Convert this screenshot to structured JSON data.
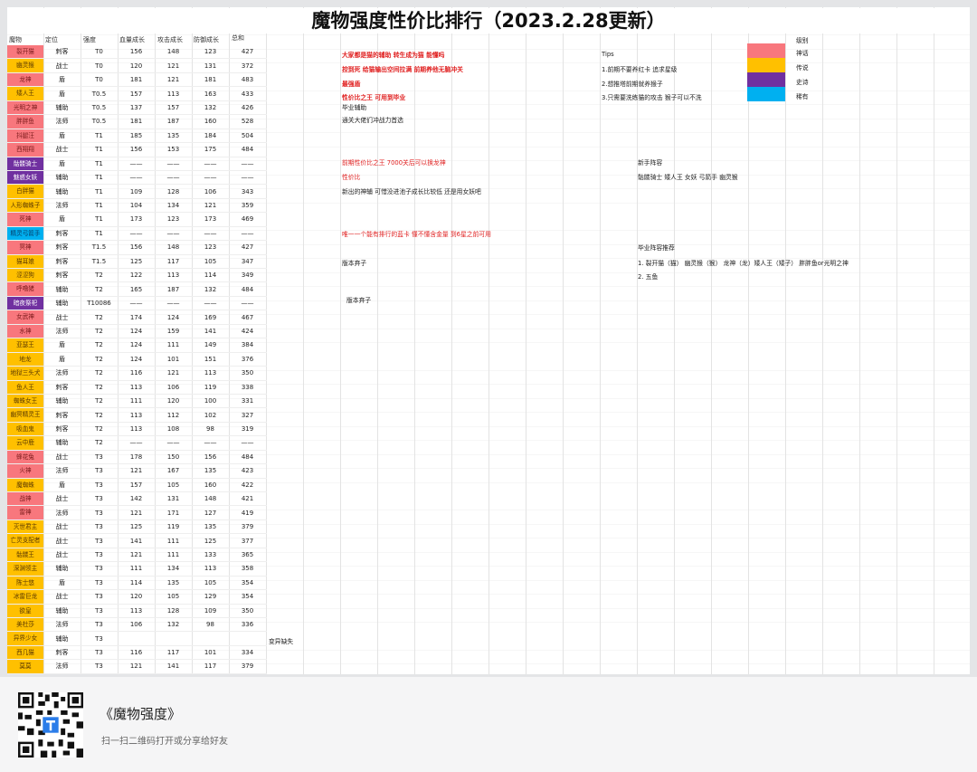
{
  "title": "魔物强度性价比排行（2023.2.28更新）",
  "headers": [
    "魔物",
    "定位",
    "强度",
    "血量成长",
    "攻击成长",
    "防御成长",
    "总和"
  ],
  "levels": {
    "label": "级别",
    "items": [
      {
        "name": "神话",
        "color": "#f8777d"
      },
      {
        "name": "传说",
        "color": "#ffc000"
      },
      {
        "name": "史诗",
        "color": "#7030a0"
      },
      {
        "name": "稀有",
        "color": "#00b0f0"
      }
    ]
  },
  "rows": [
    [
      "裂开猫",
      "刺客",
      "T0",
      "156",
      "148",
      "123",
      "427",
      0
    ],
    [
      "幽灵猴",
      "战士",
      "T0",
      "120",
      "121",
      "131",
      "372",
      1
    ],
    [
      "龙神",
      "盾",
      "T0",
      "181",
      "121",
      "181",
      "483",
      0
    ],
    [
      "矮人王",
      "盾",
      "T0.5",
      "157",
      "113",
      "163",
      "433",
      1
    ],
    [
      "光明之神",
      "辅助",
      "T0.5",
      "137",
      "157",
      "132",
      "426",
      0
    ],
    [
      "胖胖鱼",
      "法师",
      "T0.5",
      "181",
      "187",
      "160",
      "528",
      0
    ],
    [
      "抖腿汪",
      "盾",
      "T1",
      "185",
      "135",
      "184",
      "504",
      0
    ],
    [
      "西翔翔",
      "战士",
      "T1",
      "156",
      "153",
      "175",
      "484",
      0
    ],
    [
      "骷髅骑士",
      "盾",
      "T1",
      "——",
      "——",
      "——",
      "——",
      2
    ],
    [
      "魅惑女妖",
      "辅助",
      "T1",
      "——",
      "——",
      "——",
      "——",
      2
    ],
    [
      "白胖猫",
      "辅助",
      "T1",
      "109",
      "128",
      "106",
      "343",
      1
    ],
    [
      "人形蜘蛛子",
      "法师",
      "T1",
      "104",
      "134",
      "121",
      "359",
      1
    ],
    [
      "死神",
      "盾",
      "T1",
      "173",
      "123",
      "173",
      "469",
      0
    ],
    [
      "精灵弓箭手",
      "刺客",
      "T1",
      "——",
      "——",
      "——",
      "——",
      3
    ],
    [
      "冥神",
      "刺客",
      "T1.5",
      "156",
      "148",
      "123",
      "427",
      0
    ],
    [
      "猫耳娘",
      "刺客",
      "T1.5",
      "125",
      "117",
      "105",
      "347",
      1
    ],
    [
      "涩涩狗",
      "刺客",
      "T2",
      "122",
      "113",
      "114",
      "349",
      1
    ],
    [
      "呼噜猪",
      "辅助",
      "T2",
      "165",
      "187",
      "132",
      "484",
      0
    ],
    [
      "暗夜祭祀",
      "辅助",
      "T10086",
      "——",
      "——",
      "——",
      "——",
      2
    ],
    [
      "女武神",
      "战士",
      "T2",
      "174",
      "124",
      "169",
      "467",
      0
    ],
    [
      "水神",
      "法师",
      "T2",
      "124",
      "159",
      "141",
      "424",
      0
    ],
    [
      "亚瑟王",
      "盾",
      "T2",
      "124",
      "111",
      "149",
      "384",
      1
    ],
    [
      "地龙",
      "盾",
      "T2",
      "124",
      "101",
      "151",
      "376",
      1
    ],
    [
      "地狱三头犬",
      "法师",
      "T2",
      "116",
      "121",
      "113",
      "350",
      1
    ],
    [
      "鱼人王",
      "刺客",
      "T2",
      "113",
      "106",
      "119",
      "338",
      1
    ],
    [
      "蜘蛛女王",
      "辅助",
      "T2",
      "111",
      "120",
      "100",
      "331",
      1
    ],
    [
      "幽冥精灵王",
      "刺客",
      "T2",
      "113",
      "112",
      "102",
      "327",
      1
    ],
    [
      "吸血鬼",
      "刺客",
      "T2",
      "113",
      "108",
      "98",
      "319",
      1
    ],
    [
      "云中鹿",
      "辅助",
      "T2",
      "——",
      "——",
      "——",
      "——",
      1
    ],
    [
      "蜂花兔",
      "战士",
      "T3",
      "178",
      "150",
      "156",
      "484",
      0
    ],
    [
      "火神",
      "法师",
      "T3",
      "121",
      "167",
      "135",
      "423",
      0
    ],
    [
      "魔蜘蛛",
      "盾",
      "T3",
      "157",
      "105",
      "160",
      "422",
      1
    ],
    [
      "战神",
      "战士",
      "T3",
      "142",
      "131",
      "148",
      "421",
      0
    ],
    [
      "雷神",
      "法师",
      "T3",
      "121",
      "171",
      "127",
      "419",
      0
    ],
    [
      "灭世君主",
      "战士",
      "T3",
      "125",
      "119",
      "135",
      "379",
      1
    ],
    [
      "亡灵支配者",
      "战士",
      "T3",
      "141",
      "111",
      "125",
      "377",
      1
    ],
    [
      "骷髅王",
      "战士",
      "T3",
      "121",
      "111",
      "133",
      "365",
      1
    ],
    [
      "深渊领主",
      "辅助",
      "T3",
      "111",
      "134",
      "113",
      "358",
      1
    ],
    [
      "陈士悠",
      "盾",
      "T3",
      "114",
      "135",
      "105",
      "354",
      1
    ],
    [
      "冰雷巨龙",
      "战士",
      "T3",
      "120",
      "105",
      "129",
      "354",
      1
    ],
    [
      "欲皇",
      "辅助",
      "T3",
      "113",
      "128",
      "109",
      "350",
      1
    ],
    [
      "美杜莎",
      "法师",
      "T3",
      "106",
      "132",
      "98",
      "336",
      1
    ],
    [
      "异界少女",
      "辅助",
      "T3",
      "",
      "",
      "",
      "",
      1
    ],
    [
      "西几猫",
      "刺客",
      "T3",
      "116",
      "117",
      "101",
      "334",
      1
    ],
    [
      "莫莫",
      "法师",
      "T3",
      "121",
      "141",
      "117",
      "379",
      1
    ]
  ],
  "notes": {
    "n1": "大家都是猫的辅助 转生成为猫 能懂吗",
    "n2": "控到死  给猫输出空间拉满  前期养他无脑冲关",
    "n3": "最强盾",
    "n4": "性价比之王  可用到毕业",
    "n5": "毕业辅助",
    "n6": "通关大佬们冲战力首选",
    "n7": "前期性价比之王  7000关后可以换龙神",
    "n8": "性价比",
    "n9": "新出的神辅   可惜没进池子成长比较低  还是用女妖吧",
    "n10": "唯一一个能有排行的蓝卡 懂不懂含金量   到6星之前可用",
    "n11": "版本弃子",
    "n12": "版本弃子",
    "n13": "变异缺失"
  },
  "tips": {
    "title": "Tips",
    "items": [
      "1.前期不要养红卡  追求星级",
      "2.想推塔前期就养猴子",
      "3.只需要洗练猫的攻击  猴子可以不洗"
    ]
  },
  "starter": {
    "title": "新手阵容",
    "text": "骷髅骑士    矮人王  女妖  弓箭手 幽灵猴"
  },
  "endgame": {
    "title": "毕业阵容推荐",
    "items": [
      "1.  裂开猫（猫） 幽灵猴（猴）  龙神（龙）矮人王（矮子）  胖胖鱼or光明之神",
      "2.  五鱼"
    ]
  },
  "footer": {
    "title": "《魔物强度》",
    "subtitle": "扫一扫二维码打开或分享给好友"
  }
}
